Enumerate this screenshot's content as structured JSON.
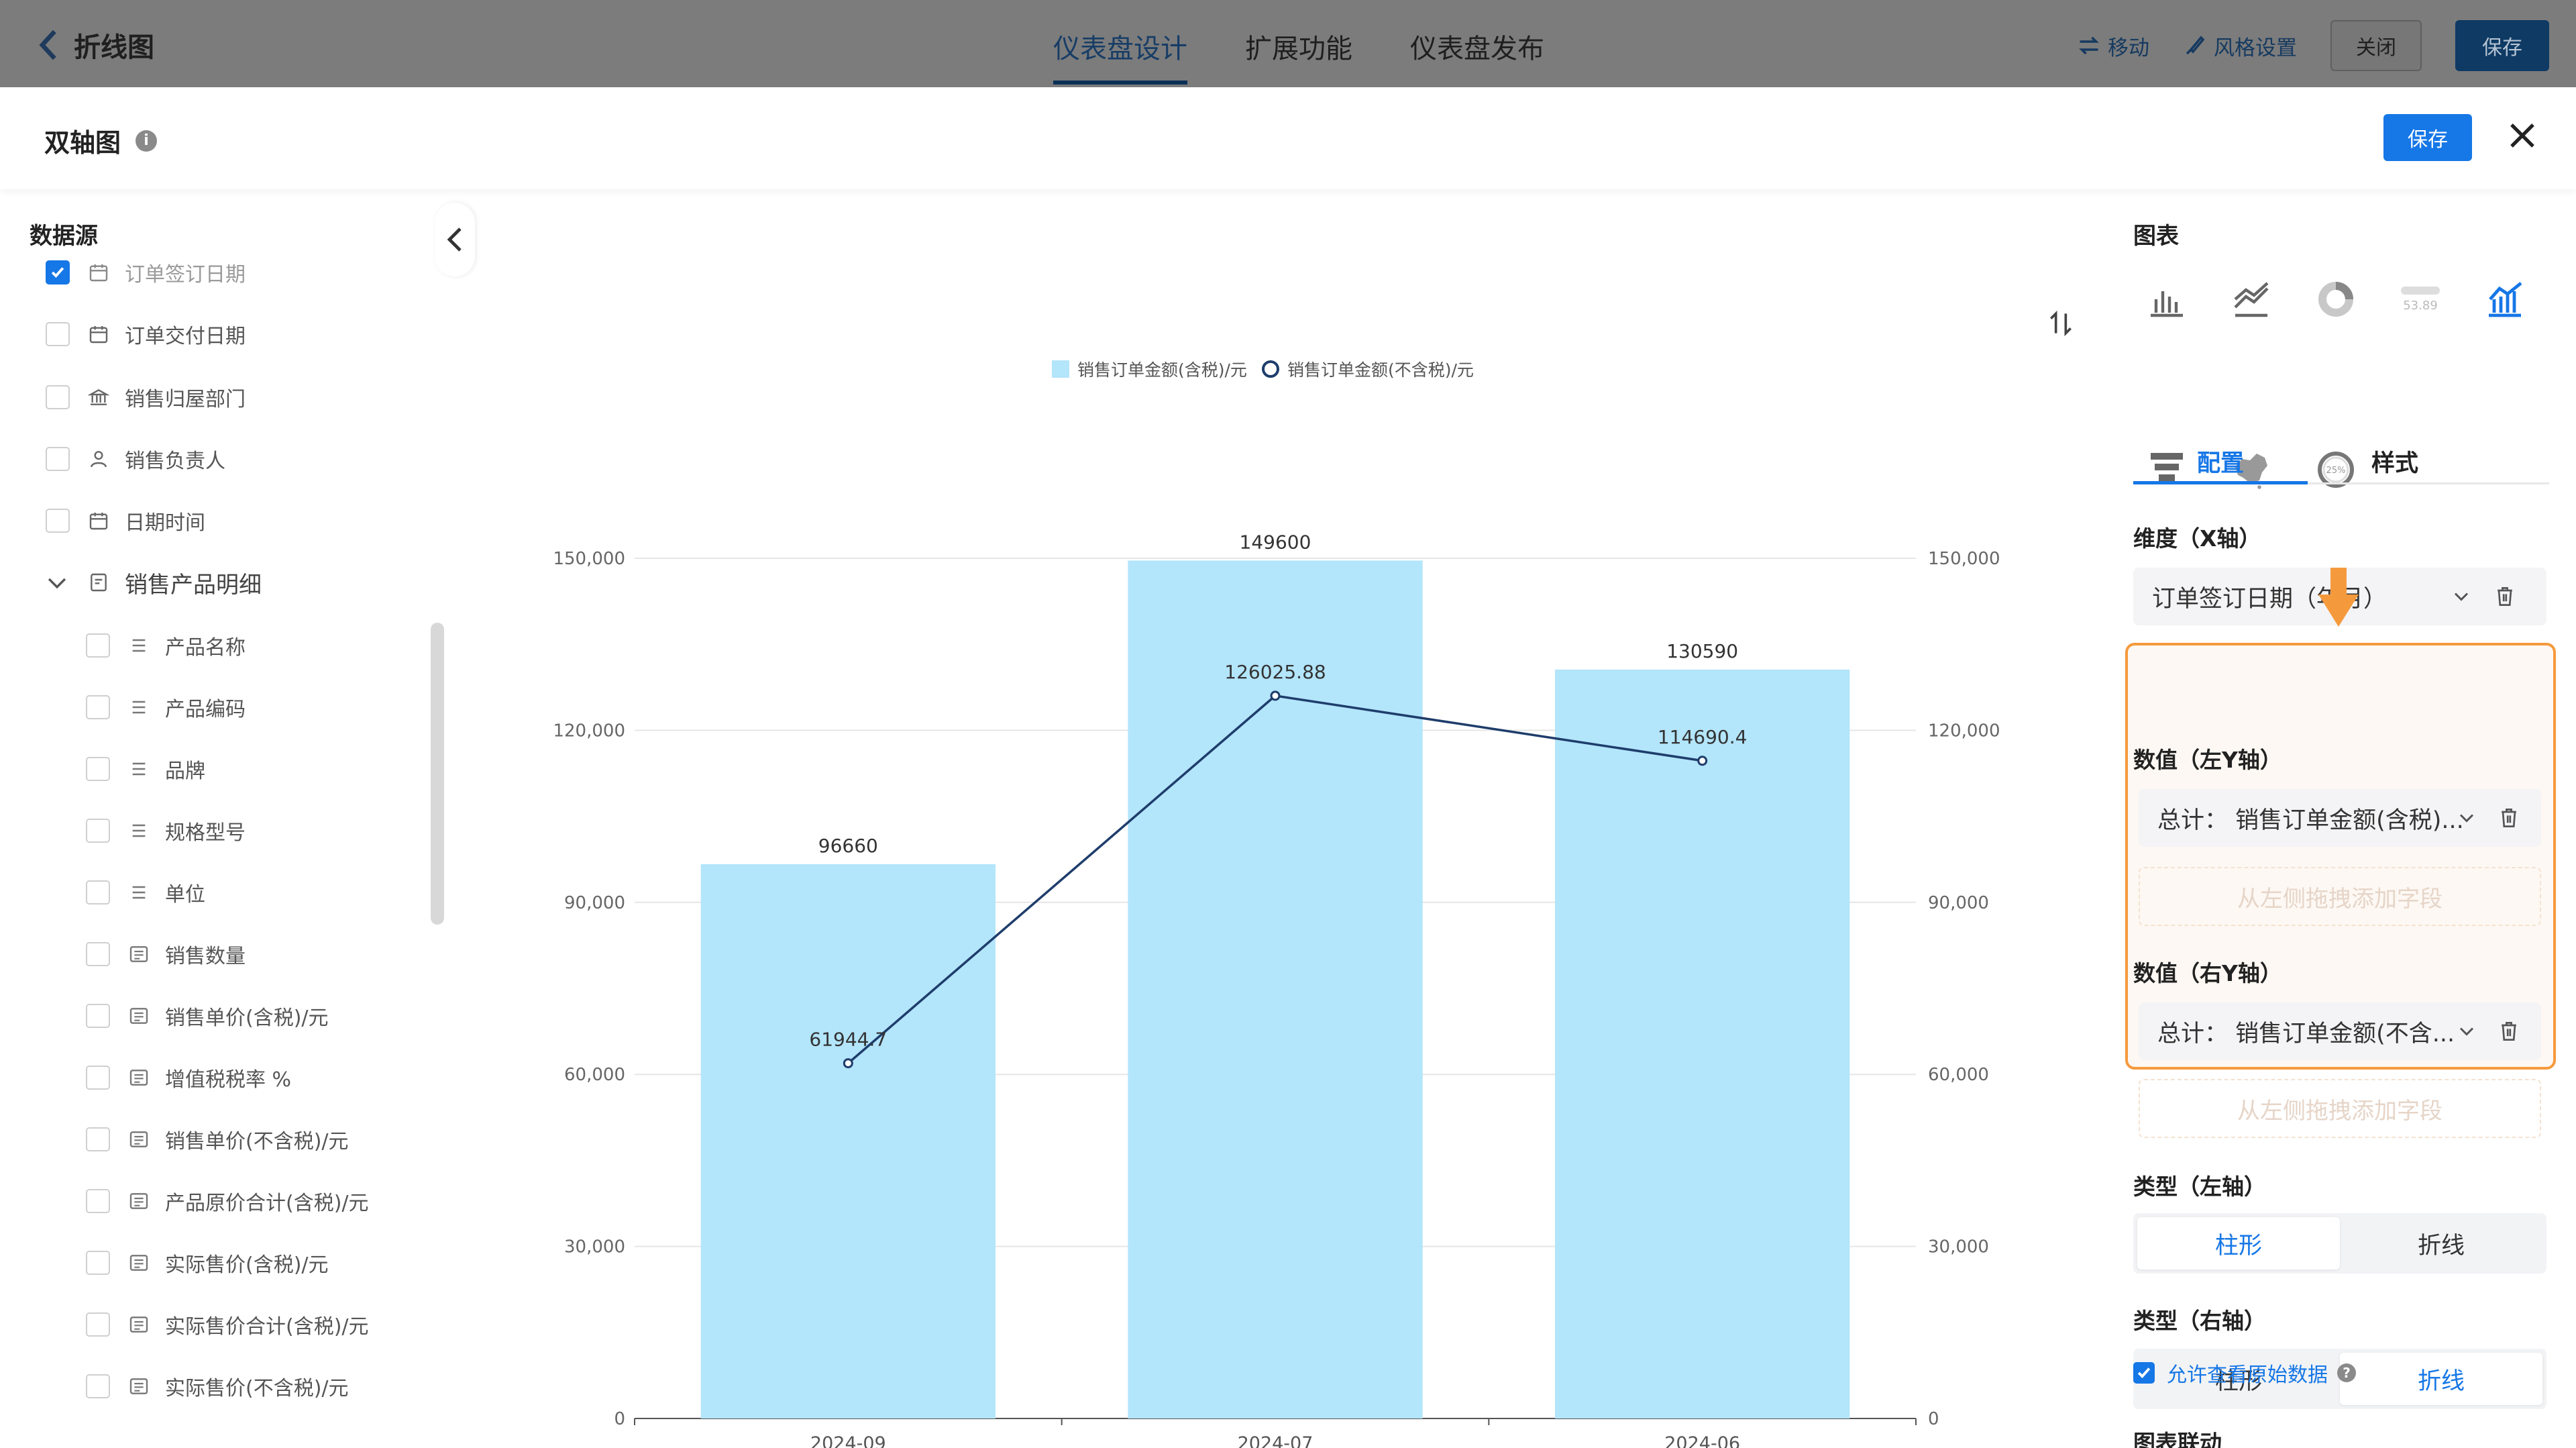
{
  "topbar": {
    "back_label": "折线图",
    "tabs": [
      {
        "label": "仪表盘设计",
        "active": true
      },
      {
        "label": "扩展功能",
        "active": false
      },
      {
        "label": "仪表盘发布",
        "active": false
      }
    ],
    "move_label": "移动",
    "style_label": "风格设置",
    "close_label": "关闭",
    "save_label": "保存"
  },
  "modal": {
    "title": "双轴图",
    "info_glyph": "i",
    "save_label": "保存"
  },
  "datasource": {
    "title": "数据源",
    "items": [
      {
        "label": "订单签订日期",
        "icon": "calendar-icon",
        "checked": true,
        "muted": true
      },
      {
        "label": "订单交付日期",
        "icon": "calendar-icon",
        "checked": false
      },
      {
        "label": "销售归屋部门",
        "icon": "bank-icon",
        "checked": false
      },
      {
        "label": "销售负责人",
        "icon": "person-icon",
        "checked": false
      },
      {
        "label": "日期时间",
        "icon": "calendar-icon",
        "checked": false
      }
    ],
    "group": {
      "label": "销售产品明细",
      "items": [
        {
          "label": "产品名称",
          "icon": "text-lines-icon"
        },
        {
          "label": "产品编码",
          "icon": "text-lines-icon"
        },
        {
          "label": "品牌",
          "icon": "text-lines-icon"
        },
        {
          "label": "规格型号",
          "icon": "text-lines-icon"
        },
        {
          "label": "单位",
          "icon": "text-lines-icon"
        },
        {
          "label": "销售数量",
          "icon": "number-icon"
        },
        {
          "label": "销售单价(含税)/元",
          "icon": "number-icon"
        },
        {
          "label": "增值税税率 %",
          "icon": "number-icon"
        },
        {
          "label": "销售单价(不含税)/元",
          "icon": "number-icon"
        },
        {
          "label": "产品原价合计(含税)/元",
          "icon": "number-icon"
        },
        {
          "label": "实际售价(含税)/元",
          "icon": "number-icon"
        },
        {
          "label": "实际售价合计(含税)/元",
          "icon": "number-icon"
        },
        {
          "label": "实际售价(不含税)/元",
          "icon": "number-icon"
        }
      ]
    }
  },
  "chart_data": {
    "type": "bar",
    "categories": [
      "2024-09",
      "2024-07",
      "2024-06"
    ],
    "series": [
      {
        "name": "销售订单金额(含税)/元",
        "kind": "bar",
        "axis": "left",
        "values": [
          96660,
          149600,
          130590
        ],
        "labels": [
          "96660",
          "149600",
          "130590"
        ],
        "color": "#b3e5fb"
      },
      {
        "name": "销售订单金额(不含税)/元",
        "kind": "line",
        "axis": "right",
        "values": [
          61944.7,
          126025.88,
          114690.4
        ],
        "labels": [
          "61944.7",
          "126025.88",
          "114690.4"
        ],
        "color": "#1e3d6b"
      }
    ],
    "ylim": [
      0,
      150000
    ],
    "y2lim": [
      0,
      150000
    ],
    "yticks": [
      "0",
      "30,000",
      "60,000",
      "90,000",
      "120,000",
      "150,000"
    ],
    "grid": true,
    "legend_position": "top"
  },
  "config": {
    "chart_title": "图表",
    "chart_types": [
      "bar-chart-icon",
      "line-chart-icon",
      "ring-chart-icon",
      "indicator-card-icon",
      "dual-axis-chart-icon",
      "funnel-chart-icon",
      "china-map-icon",
      "gauge-ring-icon"
    ],
    "indicator_value": "53.89",
    "gauge_value": "25%",
    "tabs": [
      {
        "label": "配置",
        "active": true
      },
      {
        "label": "样式",
        "active": false
      }
    ],
    "dimension_label": "维度（X轴）",
    "dimension_value": "订单签订日期（年月）",
    "left_value_label": "数值（左Y轴）",
    "left_field": "总计：  销售订单金额(含税)...",
    "drop_hint": "从左侧拖拽添加字段",
    "right_value_label": "数值（右Y轴）",
    "right_field": "总计：  销售订单金额(不含...",
    "left_type_label": "类型（左轴）",
    "right_type_label": "类型（右轴）",
    "type_bar": "柱形",
    "type_line": "折线",
    "left_type_selected": "bar",
    "right_type_selected": "line",
    "allow_raw_label": "允许查看原始数据",
    "allow_raw_checked": true,
    "help_glyph": "?",
    "linkage_label": "图表联动",
    "accent": "#1677e6",
    "highlight": "#f59a3c"
  }
}
